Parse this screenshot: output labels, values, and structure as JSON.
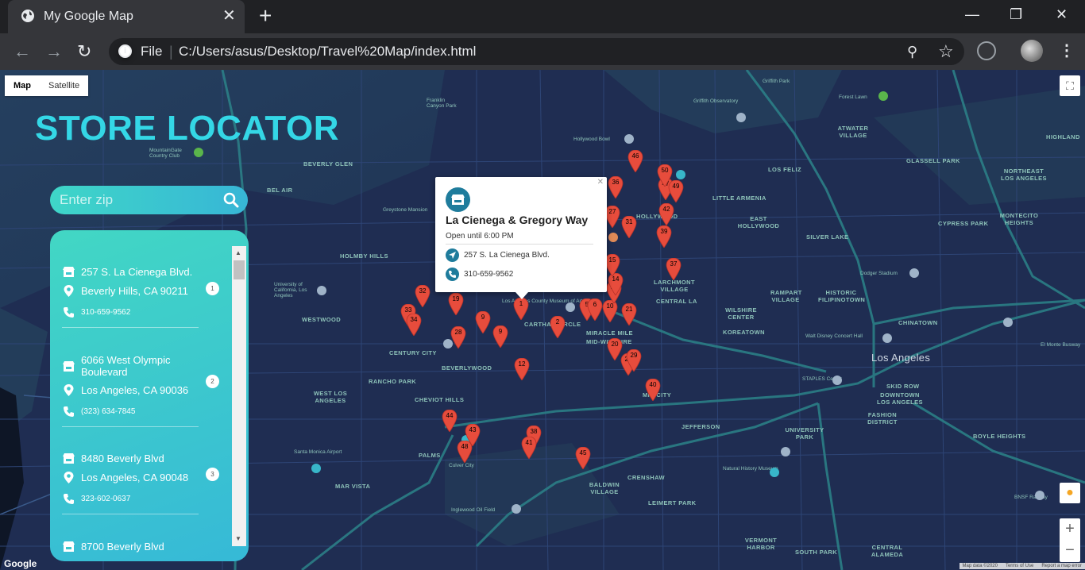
{
  "browser": {
    "tab_title": "My Google Map",
    "new_tab": "+",
    "url_scheme": "File",
    "url": "C:/Users/asus/Desktop/Travel%20Map/index.html"
  },
  "map": {
    "type_map": "Map",
    "type_satellite": "Satellite",
    "google_logo": "Google",
    "attribution": [
      "Map data ©2020",
      "Terms of Use",
      "Report a map error"
    ],
    "areas": [
      "BEVERLY GLEN",
      "BEL AIR",
      "HOLMBY HILLS",
      "WESTWOOD",
      "CENTURY CITY",
      "BEVERLYWOOD",
      "RANCHO PARK",
      "CHEVIOT HILLS",
      "WEST LOS ANGELES",
      "PALMS",
      "MAR VISTA",
      "CRENSHAW",
      "BALDWIN VILLAGE",
      "LEIMERT PARK",
      "JEFFERSON",
      "UNIVERSITY PARK",
      "FASHION DISTRICT",
      "SKID ROW",
      "DOWNTOWN LOS ANGELES",
      "CHINATOWN",
      "HISTORIC FILIPINOTOWN",
      "RAMPART VILLAGE",
      "WILSHIRE CENTER",
      "KOREATOWN",
      "LARCHMONT VILLAGE",
      "CENTRAL LA",
      "MIRACLE MILE",
      "MID-WILSHIRE",
      "CARTHAY CIRCLE",
      "HOLLYWOOD",
      "EAST HOLLYWOOD",
      "LITTLE ARMENIA",
      "LOS FELIZ",
      "SILVER LAKE",
      "ATWATER VILLAGE",
      "GLASSELL PARK",
      "HIGHLAND",
      "NORTHEAST LOS ANGELES",
      "MONTECITO HEIGHTS",
      "CYPRESS PARK",
      "BOYLE HEIGHTS",
      "MID CITY",
      "VERMONT HARBOR",
      "SOUTH PARK",
      "CENTRAL ALAMEDA"
    ],
    "city_label": "Los Angeles",
    "places": [
      "Hollywood Bowl",
      "Griffith Observatory",
      "Forest Lawn",
      "Dodger Stadium",
      "Santa Monica Airport",
      "Culver City",
      "Inglewood Oil Field",
      "Natural History Museum",
      "STAPLES Center",
      "Walt Disney Concert Hall",
      "Los Angeles County Museum of Art",
      "University of California, Los Angeles",
      "MountainGate Country Club",
      "Greystone Mansion",
      "Franklin Canyon Park",
      "Griffith Park",
      "El Monte Busway",
      "BNSF Railway"
    ],
    "markers": [
      "1",
      "2",
      "5",
      "6",
      "9",
      "9",
      "10",
      "12",
      "13",
      "14",
      "15",
      "19",
      "20",
      "21",
      "26",
      "27",
      "28",
      "29",
      "31",
      "32",
      "33",
      "34",
      "36",
      "37",
      "38",
      "39",
      "40",
      "41",
      "42",
      "43",
      "44",
      "45",
      "46",
      "47",
      "48",
      "49",
      "50"
    ]
  },
  "locator": {
    "heading": "STORE LOCATOR",
    "search_placeholder": "Enter zip",
    "stores": [
      {
        "address": "257 S. La Cienega Blvd.",
        "city": "Beverly Hills, CA 90211",
        "phone": "310-659-9562",
        "number": "1"
      },
      {
        "address": "6066 West Olympic Boulevard",
        "city": "Los Angeles, CA 90036",
        "phone": "(323) 634-7845",
        "number": "2"
      },
      {
        "address": "8480 Beverly Blvd",
        "city": "Los Angeles, CA 90048",
        "phone": "323-602-0637",
        "number": "3"
      },
      {
        "address": "8700 Beverly Blvd"
      }
    ]
  },
  "infowindow": {
    "name": "La Cienega & Gregory Way",
    "hours": "Open until 6:00 PM",
    "address": "257 S. La Cienega Blvd.",
    "phone": "310-659-9562"
  },
  "colors": {
    "accent": "#34d7e6",
    "panel_start": "#42d7c4",
    "panel_end": "#36b9d7",
    "map_bg": "#1f2d52",
    "marker": "#e74c3c",
    "store_icon": "#1f7c9c"
  }
}
